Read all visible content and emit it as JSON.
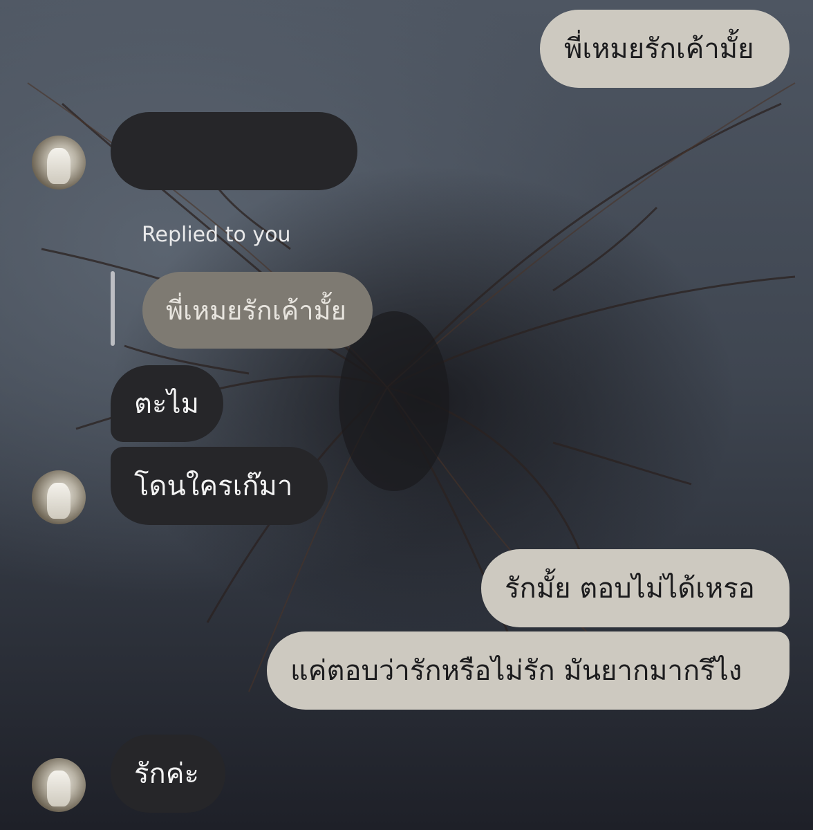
{
  "messages": {
    "out1": "พี่เหมยรักเค้ามั้ย",
    "in_redacted": "",
    "reply_label": "Replied to you",
    "quoted": "พี่เหมยรักเค้ามั้ย",
    "in1": "ตะไม",
    "in2": "โดนใครเก๊มา",
    "out2": "รักมั้ย ตอบไม่ได้เหรอ",
    "out3": "แค่ตอบว่ารักหรือไม่รัก มันยากมากรึไง",
    "in3": "รักค่ะ"
  },
  "colors": {
    "outgoing_bubble": "#cdc9c0",
    "incoming_bubble": "#262629",
    "quoted_bubble": "#7e7a72"
  }
}
